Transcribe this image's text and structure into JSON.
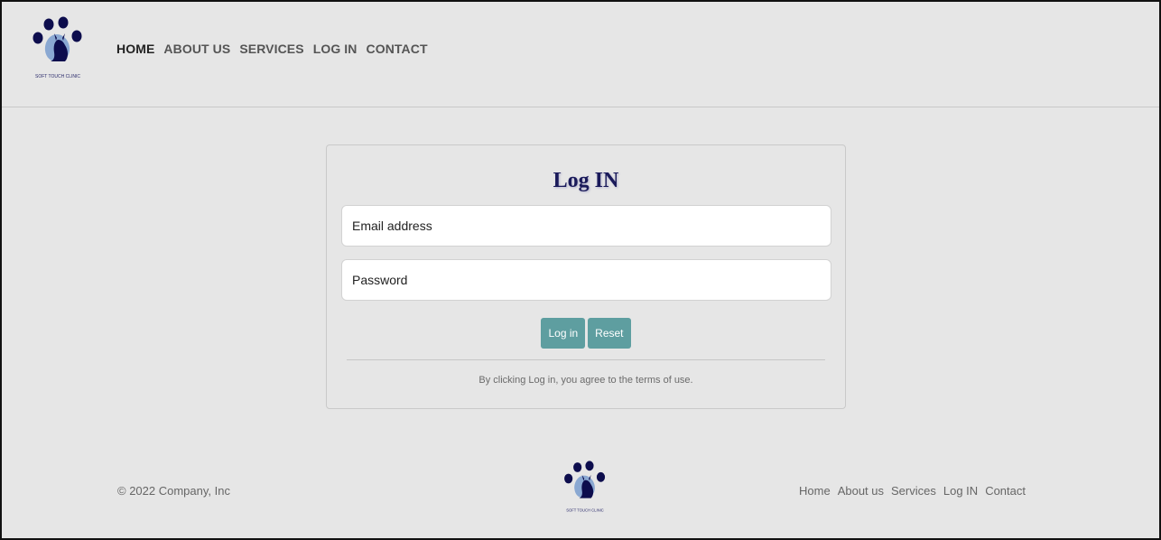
{
  "brand": {
    "logo_text": "SOFT TOUCH CLINIC",
    "logo_colors": {
      "paw": "#0d0d4d",
      "cat": "#8aa8d2"
    }
  },
  "header": {
    "nav": [
      {
        "label": "HOME",
        "active": true
      },
      {
        "label": "ABOUT US",
        "active": false
      },
      {
        "label": "SERVICES",
        "active": false
      },
      {
        "label": "LOG IN",
        "active": false
      },
      {
        "label": "CONTACT",
        "active": false
      }
    ]
  },
  "login": {
    "title": "Log IN",
    "email_placeholder": "Email address",
    "password_placeholder": "Password",
    "login_button": "Log in",
    "reset_button": "Reset",
    "terms": "By clicking Log in, you agree to the terms of use."
  },
  "footer": {
    "copyright": "© 2022 Company, Inc",
    "nav": [
      "Home",
      "About us",
      "Services",
      "Log IN",
      "Contact"
    ]
  },
  "colors": {
    "background": "#e6e6e6",
    "button": "#5e9ea0",
    "title": "#1a1a5a"
  }
}
